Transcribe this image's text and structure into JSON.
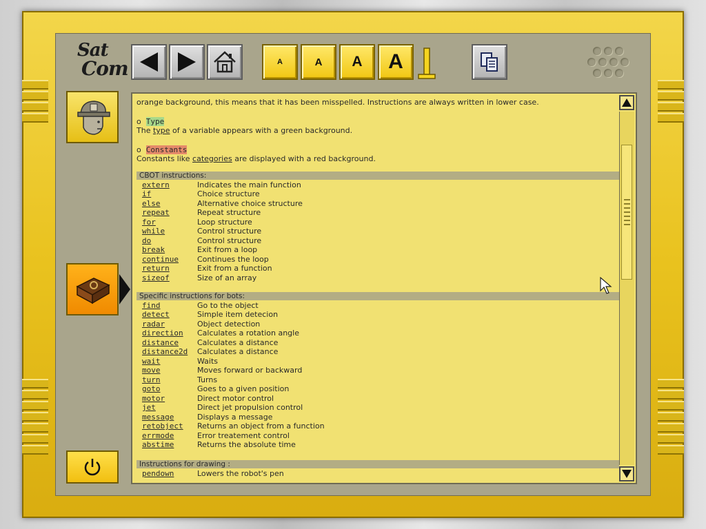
{
  "app": {
    "logo_line1": "Sat",
    "logo_line2": "Com"
  },
  "toolbar": {
    "font_sizes": [
      {
        "label": "A",
        "size": 11
      },
      {
        "label": "A",
        "size": 15
      },
      {
        "label": "A",
        "size": 21
      },
      {
        "label": "A",
        "size": 30
      }
    ]
  },
  "intro": {
    "line1": "orange background, this means that it has been misspelled. Instructions are always written in lower case.",
    "type_bullet": "o",
    "type_title": "Type",
    "type_line_pre": "The ",
    "type_line_link": "type",
    "type_line_post": " of a variable appears with a green background.",
    "const_bullet": "o",
    "const_title": "Constants",
    "const_line_pre": "Constants like ",
    "const_line_link": "categories",
    "const_line_post": " are displayed with a red background."
  },
  "sections": [
    {
      "title": "CBOT instructions:",
      "rows": [
        {
          "keyword": "extern",
          "description": "Indicates the main function"
        },
        {
          "keyword": "if",
          "description": "Choice structure"
        },
        {
          "keyword": "else",
          "description": "Alternative choice structure"
        },
        {
          "keyword": "repeat",
          "description": "Repeat structure"
        },
        {
          "keyword": "for",
          "description": "Loop structure"
        },
        {
          "keyword": "while",
          "description": "Control structure"
        },
        {
          "keyword": "do",
          "description": "Control structure"
        },
        {
          "keyword": "break",
          "description": "Exit from a loop"
        },
        {
          "keyword": "continue",
          "description": "Continues the loop"
        },
        {
          "keyword": "return",
          "description": "Exit from a function"
        },
        {
          "keyword": "sizeof",
          "description": "Size of an array"
        }
      ]
    },
    {
      "title": "Specific instructions for bots:",
      "rows": [
        {
          "keyword": "find",
          "description": "Go to the object"
        },
        {
          "keyword": "detect",
          "description": "Simple item detecion"
        },
        {
          "keyword": "radar",
          "description": "Object detection"
        },
        {
          "keyword": "direction",
          "description": "Calculates a rotation angle"
        },
        {
          "keyword": "distance",
          "description": "Calculates a distance"
        },
        {
          "keyword": "distance2d",
          "description": "Calculates a distance"
        },
        {
          "keyword": "wait",
          "description": "Waits"
        },
        {
          "keyword": "move",
          "description": "Moves forward or backward"
        },
        {
          "keyword": "turn",
          "description": "Turns"
        },
        {
          "keyword": "goto",
          "description": "Goes to a given position"
        },
        {
          "keyword": "motor",
          "description": "Direct motor control"
        },
        {
          "keyword": "jet",
          "description": "Direct jet propulsion control"
        },
        {
          "keyword": "message",
          "description": "Displays a message"
        },
        {
          "keyword": "retobject",
          "description": "Returns an object from a function"
        },
        {
          "keyword": "errmode",
          "description": "Error treatement control"
        },
        {
          "keyword": "abstime",
          "description": "Returns the absolute time"
        }
      ]
    },
    {
      "title": "Instructions for drawing :",
      "rows": [
        {
          "keyword": "pendown",
          "description": "Lowers the robot's pen"
        }
      ]
    }
  ],
  "colors": {
    "frame_yellow": "#f0d23a",
    "page_bg": "#f1e172",
    "section_header": "#b3ad84",
    "type_highlight": "#a7d88a",
    "constant_highlight": "#e58a6a",
    "active_tab": "#f5a300"
  },
  "icons": {
    "back": "arrow-left-icon",
    "forward": "arrow-right-icon",
    "home": "home-icon",
    "copy": "copy-icon",
    "agent": "agent-head-icon",
    "book": "book-icon",
    "power": "power-icon"
  }
}
